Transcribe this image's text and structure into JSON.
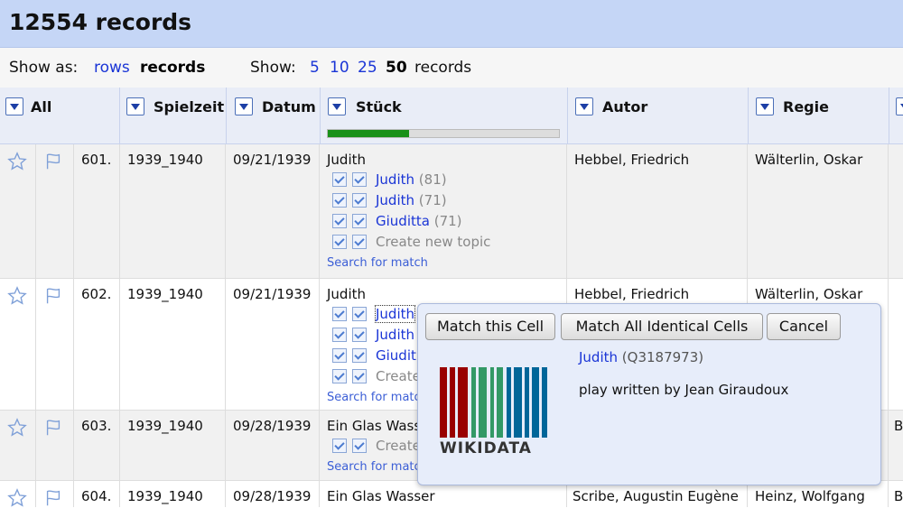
{
  "header": {
    "title": "12554 records"
  },
  "viewbar": {
    "show_as_label": "Show as:",
    "rows": "rows",
    "records": "records",
    "show_label": "Show:",
    "counts": [
      "5",
      "10",
      "25",
      "50"
    ],
    "records_suffix": "records"
  },
  "columns": {
    "all": "All",
    "spielzeit": "Spielzeit",
    "datum": "Datum",
    "stueck": "Stück",
    "autor": "Autor",
    "regie": "Regie",
    "stueck_progress": 0.35
  },
  "rows": [
    {
      "num": "601.",
      "spielzeit": "1939_1940",
      "datum": "09/21/1939",
      "stueck": "Judith",
      "autor": "Hebbel, Friedrich",
      "regie": "Wälterlin, Oskar",
      "candidates": [
        {
          "name": "Judith",
          "score": "(81)"
        },
        {
          "name": "Judith",
          "score": "(71)"
        },
        {
          "name": "Giuditta",
          "score": "(71)"
        }
      ],
      "create": "Create new topic",
      "search": "Search for match"
    },
    {
      "num": "602.",
      "spielzeit": "1939_1940",
      "datum": "09/21/1939",
      "stueck": "Judith",
      "autor": "Hebbel, Friedrich",
      "regie": "Wälterlin, Oskar",
      "candidates": [
        {
          "name": "Judith"
        },
        {
          "name": "Judith"
        },
        {
          "name": "Giudit"
        }
      ],
      "create": "Create",
      "search": "Search for matc"
    },
    {
      "num": "603.",
      "spielzeit": "1939_1940",
      "datum": "09/28/1939",
      "stueck": "Ein Glas Wass",
      "extra": "B",
      "create": "Create",
      "search": "Search for matc"
    },
    {
      "num": "604.",
      "spielzeit": "1939_1940",
      "datum": "09/28/1939",
      "stueck": "Ein Glas Wasser",
      "autor": "Scribe, Augustin Eugène",
      "regie": "Heinz, Wolfgang",
      "extra": "B"
    }
  ],
  "popup": {
    "match_cell": "Match this Cell",
    "match_all": "Match All Identical Cells",
    "cancel": "Cancel",
    "entity_name": "Judith",
    "entity_id": "(Q3187973)",
    "description": "play written by Jean Giraudoux",
    "logo_text": "WIKIDATA"
  }
}
